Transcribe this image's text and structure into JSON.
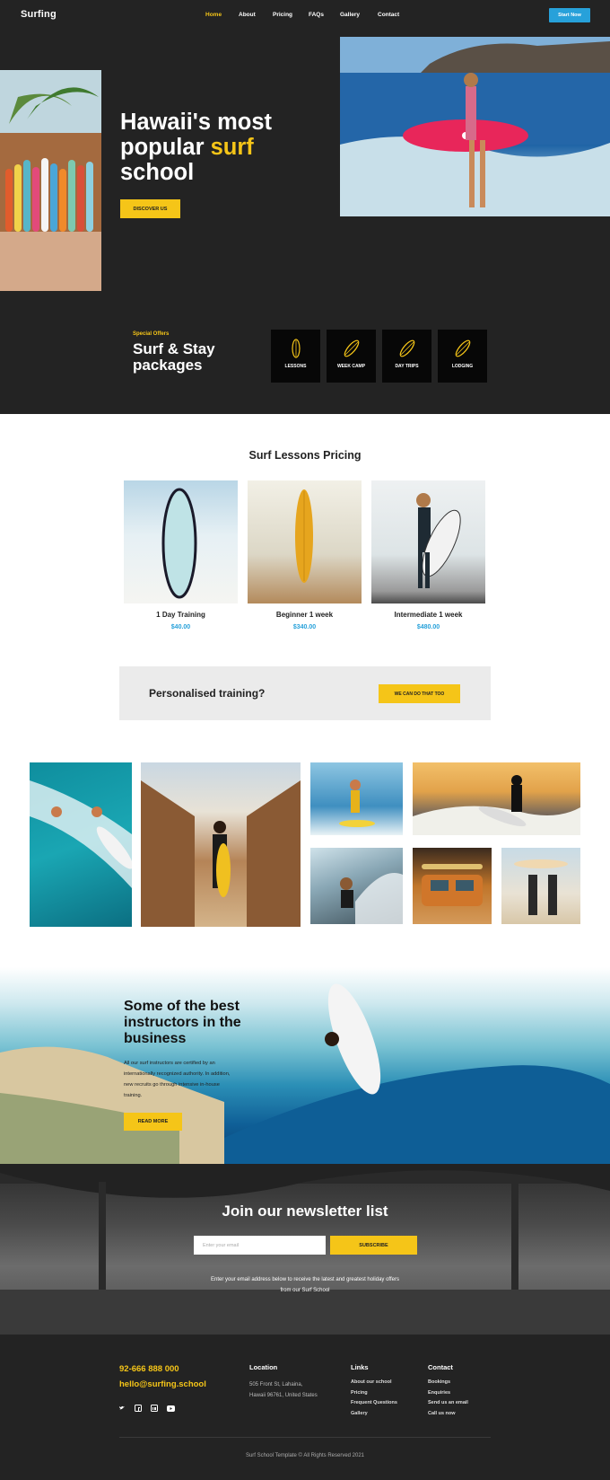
{
  "header": {
    "logo": "Surfing",
    "nav": [
      "Home",
      "About",
      "Pricing",
      "FAQs",
      "Gallery",
      "Contact"
    ],
    "cta": "Start Now"
  },
  "hero": {
    "title_line1": "Hawaii's most",
    "title_line2a": "popular ",
    "title_line2b": "surf",
    "title_line3": "school",
    "button": "DISCOVER US"
  },
  "offers": {
    "kicker": "Special Offers",
    "title_line1": "Surf & Stay",
    "title_line2": "packages",
    "items": [
      "LESSONS",
      "WEEK CAMP",
      "DAY TRIPS",
      "LODGING"
    ]
  },
  "pricing": {
    "title": "Surf Lessons Pricing",
    "plans": [
      {
        "name": "1 Day Training",
        "price": "$40.00"
      },
      {
        "name": "Beginner 1 week",
        "price": "$340.00"
      },
      {
        "name": "Intermediate 1 week",
        "price": "$480.00"
      }
    ]
  },
  "cta": {
    "text": "Personalised training?",
    "button": "WE CAN DO THAT TOO"
  },
  "instructors": {
    "title_line1": "Some of the best",
    "title_line2": "instructors in the",
    "title_line3": "business",
    "body_lines": [
      "All our surf instructors are certified by an",
      "internationally recognized authority. In addition,",
      "new recruits go through intensive in-house",
      "training."
    ],
    "button": "READ MORE"
  },
  "newsletter": {
    "title": "Join our newsletter list",
    "placeholder": "Enter your email",
    "button": "SUBSCRIBE",
    "note_line1": "Enter your email address below to receive the latest and greatest holiday offers",
    "note_line2": "from our Surf School"
  },
  "footer": {
    "phone": "92-666 888 000",
    "email": "hello@surfing.school",
    "location_heading": "Location",
    "address_line1": "505 Front St, Lahaina,",
    "address_line2": "Hawaii 96761, United States",
    "links_heading": "Links",
    "links": [
      "About our school",
      "Pricing",
      "Frequent Questions",
      "Gallery"
    ],
    "contact_heading": "Contact",
    "contact": [
      "Bookings",
      "Enquiries",
      "Send us an email",
      "Call us now"
    ],
    "copyright": "Surf School Template  © All Rights Reserved 2021"
  },
  "colors": {
    "accent": "#f5c518",
    "blue": "#27a1da",
    "dark": "#232323"
  }
}
